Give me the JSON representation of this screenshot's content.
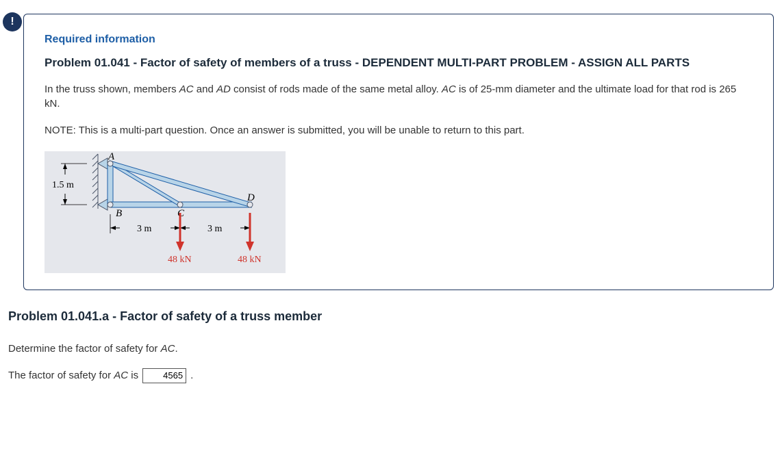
{
  "alert_icon": "!",
  "required_info_label": "Required information",
  "problem_title": "Problem 01.041 - Factor of safety of members of a truss - DEPENDENT MULTI-PART PROBLEM - ASSIGN ALL PARTS",
  "desc_prefix": "In the truss shown, members ",
  "desc_ac": "AC",
  "desc_and": " and ",
  "desc_ad": "AD",
  "desc_mid": " consist of rods made of the same metal alloy. ",
  "desc_ac2": "AC",
  "desc_suffix": " is of 25-mm diameter and the ultimate load for that rod is 265 kN.",
  "note": "NOTE: This is a multi-part question. Once an answer is submitted, you will be unable to return to this part.",
  "figure": {
    "label_A": "A",
    "label_B": "B",
    "label_C": "C",
    "label_D": "D",
    "dim_height": "1.5 m",
    "dim_span1": "3 m",
    "dim_span2": "3 m",
    "load1": "48 kN",
    "load2": "48 kN"
  },
  "sub_title": "Problem 01.041.a - Factor of safety of a truss member",
  "q_prefix": "Determine the factor of safety for ",
  "q_ac": "AC",
  "q_suffix": ".",
  "ans_prefix": "The factor of safety for ",
  "ans_ac": "AC",
  "ans_mid": " is",
  "ans_value": "4565",
  "ans_suffix": "."
}
